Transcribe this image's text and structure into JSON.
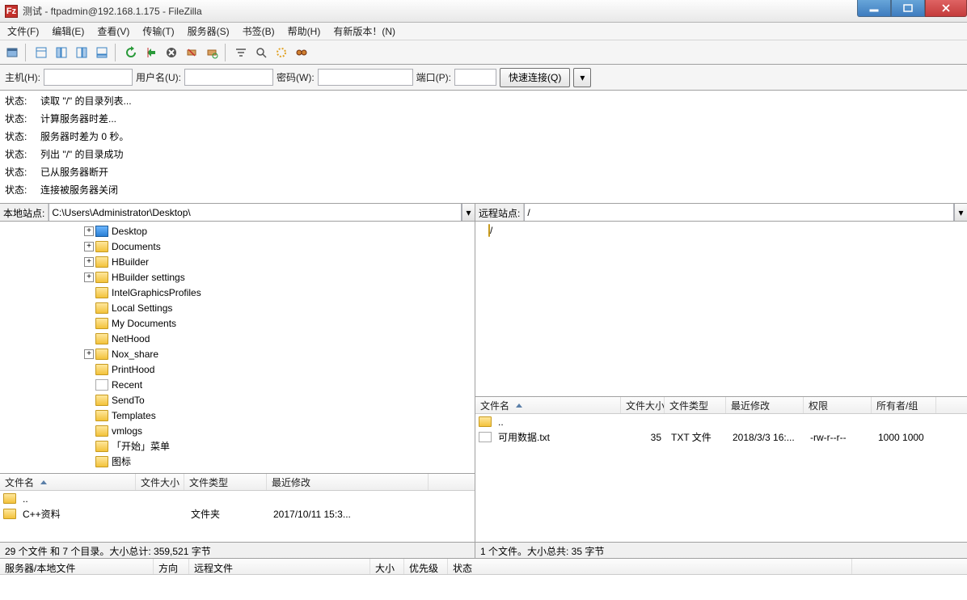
{
  "window": {
    "title": "测试 - ftpadmin@192.168.1.175 - FileZilla",
    "logo": "Fz"
  },
  "menu": [
    "文件(F)",
    "编辑(E)",
    "查看(V)",
    "传输(T)",
    "服务器(S)",
    "书签(B)",
    "帮助(H)",
    "有新版本！(N)"
  ],
  "quick": {
    "host_lbl": "主机(H):",
    "user_lbl": "用户名(U):",
    "pass_lbl": "密码(W):",
    "port_lbl": "端口(P):",
    "connect": "快速连接(Q)"
  },
  "log_label": "状态:",
  "log": [
    "读取 \"/\" 的目录列表...",
    "计算服务器时差...",
    "服务器时差为 0 秒。",
    "列出 \"/\" 的目录成功",
    "已从服务器断开",
    "连接被服务器关闭"
  ],
  "local": {
    "site_lbl": "本地站点:",
    "path": "C:\\Users\\Administrator\\Desktop\\",
    "tree": [
      {
        "indent": 104,
        "exp": "+",
        "icon": "desktop",
        "label": "Desktop"
      },
      {
        "indent": 104,
        "exp": "+",
        "icon": "folder",
        "label": "Documents"
      },
      {
        "indent": 104,
        "exp": "+",
        "icon": "folder",
        "label": "HBuilder"
      },
      {
        "indent": 104,
        "exp": "+",
        "icon": "folder",
        "label": "HBuilder settings"
      },
      {
        "indent": 104,
        "exp": "",
        "icon": "folder",
        "label": "IntelGraphicsProfiles"
      },
      {
        "indent": 104,
        "exp": "",
        "icon": "folder",
        "label": "Local Settings"
      },
      {
        "indent": 104,
        "exp": "",
        "icon": "folder",
        "label": "My Documents"
      },
      {
        "indent": 104,
        "exp": "",
        "icon": "folder",
        "label": "NetHood"
      },
      {
        "indent": 104,
        "exp": "+",
        "icon": "folder",
        "label": "Nox_share"
      },
      {
        "indent": 104,
        "exp": "",
        "icon": "folder",
        "label": "PrintHood"
      },
      {
        "indent": 104,
        "exp": "",
        "icon": "shortcut",
        "label": "Recent"
      },
      {
        "indent": 104,
        "exp": "",
        "icon": "folder",
        "label": "SendTo"
      },
      {
        "indent": 104,
        "exp": "",
        "icon": "folder",
        "label": "Templates"
      },
      {
        "indent": 104,
        "exp": "",
        "icon": "folder",
        "label": "vmlogs"
      },
      {
        "indent": 104,
        "exp": "",
        "icon": "folder",
        "label": "「开始」菜单"
      },
      {
        "indent": 104,
        "exp": "",
        "icon": "folder",
        "label": "图标"
      }
    ],
    "list_cols": [
      "文件名",
      "文件大小",
      "文件类型",
      "最近修改"
    ],
    "list_widths": [
      168,
      60,
      102,
      200
    ],
    "list": [
      {
        "name": "..",
        "size": "",
        "type": "",
        "mod": ""
      },
      {
        "name": "C++资料",
        "size": "",
        "type": "文件夹",
        "mod": "2017/10/11 15:3..."
      }
    ],
    "status": "29 个文件 和 7 个目录。大小总计: 359,521 字节"
  },
  "remote": {
    "site_lbl": "远程站点:",
    "path": "/",
    "root_label": "/",
    "list_cols": [
      "文件名",
      "文件大小",
      "文件类型",
      "最近修改",
      "权限",
      "所有者/组"
    ],
    "list_widths": [
      180,
      54,
      76,
      96,
      84,
      80
    ],
    "list": [
      {
        "name": "..",
        "size": "",
        "type": "",
        "mod": "",
        "perm": "",
        "owner": ""
      },
      {
        "name": "可用数据.txt",
        "size": "35",
        "type": "TXT 文件",
        "mod": "2018/3/3 16:...",
        "perm": "-rw-r--r--",
        "owner": "1000 1000"
      }
    ],
    "status": "1 个文件。大小总共: 35 字节"
  },
  "queue_cols": [
    "服务器/本地文件",
    "方向",
    "远程文件",
    "大小",
    "优先级",
    "状态"
  ],
  "queue_widths": [
    190,
    44,
    224,
    42,
    54,
    500
  ]
}
